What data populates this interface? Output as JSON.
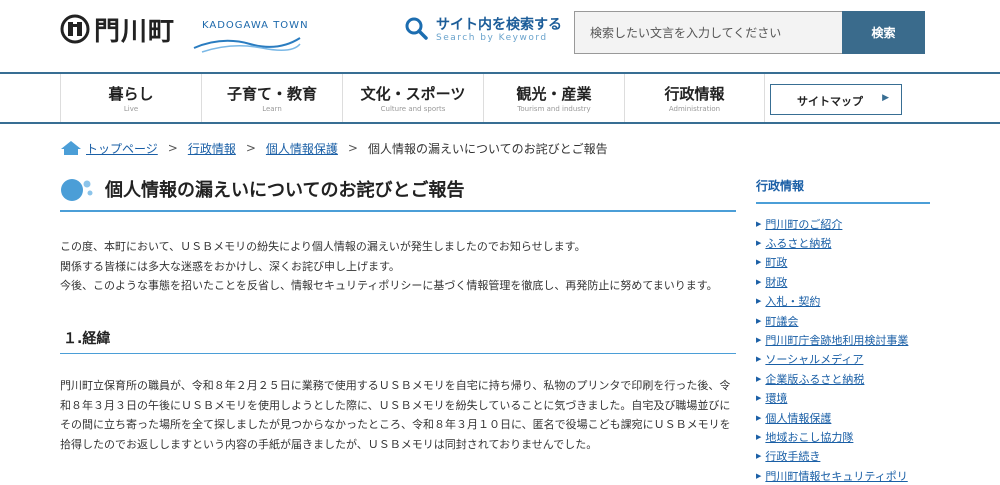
{
  "header": {
    "logo_name": "門川町",
    "logo_en": "KADOGAWA TOWN",
    "search_title": "サイト内を検索する",
    "search_subtitle": "Search by Keyword",
    "search_placeholder": "検索したい文言を入力してください",
    "search_button": "検索",
    "brand_color": "#386e93"
  },
  "nav": {
    "items": [
      {
        "label": "暮らし",
        "sub": "Live"
      },
      {
        "label": "子育て・教育",
        "sub": "Learn"
      },
      {
        "label": "文化・スポーツ",
        "sub": "Culture and sports"
      },
      {
        "label": "観光・産業",
        "sub": "Tourism and industry"
      },
      {
        "label": "行政情報",
        "sub": "Administration"
      }
    ],
    "sitemap_label": "サイトマップ"
  },
  "breadcrumb": {
    "items": [
      "トップページ",
      "行政情報",
      "個人情報保護"
    ],
    "current": "個人情報の漏えいについてのお詫びとご報告"
  },
  "main": {
    "title": "個人情報の漏えいについてのお詫びとご報告",
    "intro": "この度、本町において、ＵＳＢメモリの紛失により個人情報の漏えいが発生しましたのでお知らせします。\n関係する皆様には多大な迷惑をおかけし、深くお詫び申し上げます。\n今後、このような事態を招いたことを反省し、情報セキュリティポリシーに基づく情報管理を徹底し、再発防止に努めてまいります。",
    "section_heading": "１.経緯",
    "section_body": "門川町立保育所の職員が、令和８年２月２５日に業務で使用するＵＳＢメモリを自宅に持ち帰り、私物のプリンタで印刷を行った後、令和８年３月３日の午後にＵＳＢメモリを使用しようとした際に、ＵＳＢメモリを紛失していることに気づきました。自宅及び職場並びにその間に立ち寄った場所を全て探しましたが見つからなかったところ、令和８年３月１０日に、匿名で役場こども課宛にＵＳＢメモリを拾得したのでお返ししますという内容の手紙が届きましたが、ＵＳＢメモリは同封されておりませんでした。"
  },
  "sidebar": {
    "title": "行政情報",
    "items": [
      "門川町のご紹介",
      "ふるさと納税",
      "町政",
      "財政",
      "入札・契約",
      "町議会",
      "門川町庁舎跡地利用検討事業",
      "ソーシャルメディア",
      "企業版ふるさと納税",
      "環境",
      "個人情報保護",
      "地域おこし協力隊",
      "行政手続き",
      "門川町情報セキュリティポリ"
    ]
  },
  "colors": {
    "link": "#1a5fa6",
    "accent_blue": "#4b9ed7",
    "search_button_bg": "#3a6b8c"
  },
  "icons": [
    "town-seal-icon",
    "search-icon",
    "home-icon",
    "title-circle-icon",
    "chevron-right-icon"
  ]
}
